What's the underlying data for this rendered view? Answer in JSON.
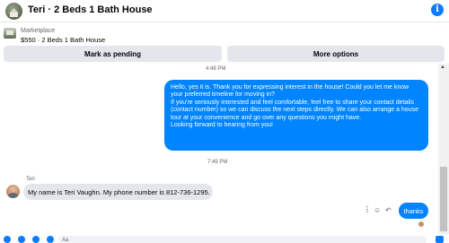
{
  "header": {
    "title": "Teri · 2 Beds 1 Bath House",
    "info_icon": "info-icon"
  },
  "listing": {
    "label": "Marketplace",
    "title": "$550 · 2 Beds 1 Bath House"
  },
  "actions": {
    "pending_label": "Mark as pending",
    "more_label": "More options"
  },
  "conversation": {
    "timestamp_1": "4:48 PM",
    "outgoing_1": [
      "Hello, yes it is. Thank you for expressing interest in the house! Could you let me know your preferred timeline for moving in?",
      "If you're seriously interested and feel comfortable, feel free to share your contact details (contact number) so we can discuss the next steps directly. We can also arrange a house tour at your convenience and go over any questions you might have.",
      "Looking forward to hearing from you!"
    ],
    "timestamp_2": "7:49 PM",
    "sender_name": "Teri",
    "incoming_1": "My name is Teri Vaughn. My phone number is 812-736-1295.",
    "outgoing_2": "thanks"
  },
  "composer": {
    "placeholder": "Aa"
  },
  "colors": {
    "accent": "#0084ff",
    "incoming_bubble": "#e4e6eb"
  }
}
